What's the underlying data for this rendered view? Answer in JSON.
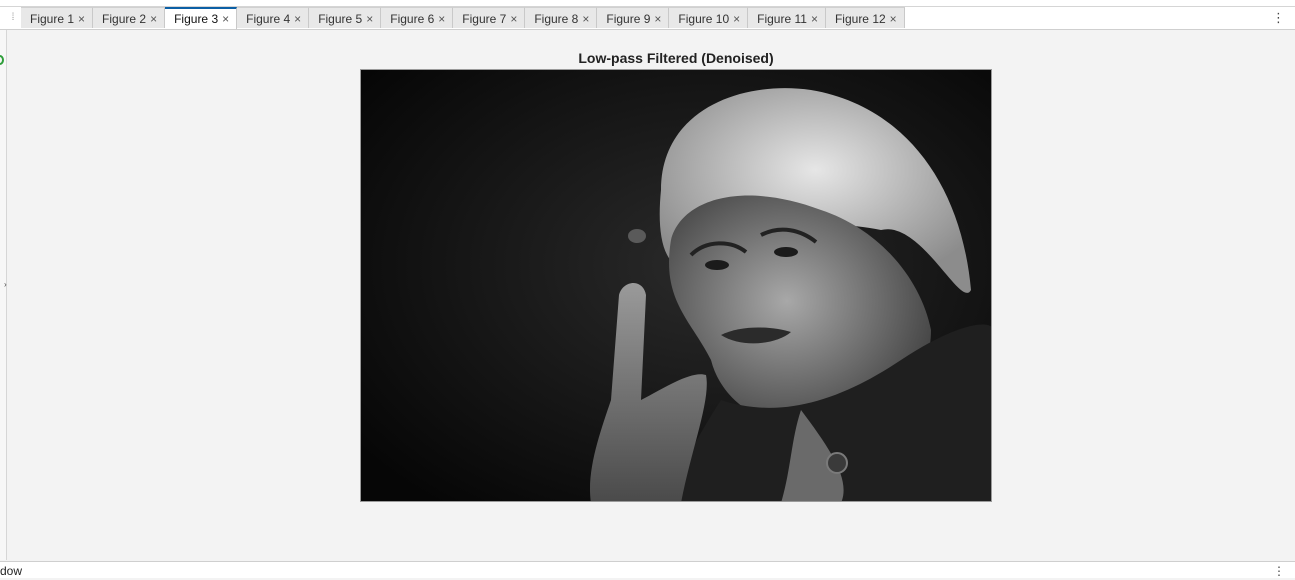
{
  "tabs": [
    {
      "label": "Figure 1",
      "close": "×"
    },
    {
      "label": "Figure 2",
      "close": "×"
    },
    {
      "label": "Figure 3",
      "close": "×",
      "active": true
    },
    {
      "label": "Figure 4",
      "close": "×"
    },
    {
      "label": "Figure 5",
      "close": "×"
    },
    {
      "label": "Figure 6",
      "close": "×"
    },
    {
      "label": "Figure 7",
      "close": "×"
    },
    {
      "label": "Figure 8",
      "close": "×"
    },
    {
      "label": "Figure 9",
      "close": "×"
    },
    {
      "label": "Figure 10",
      "close": "×"
    },
    {
      "label": "Figure 11",
      "close": "×"
    },
    {
      "label": "Figure 12",
      "close": "×"
    }
  ],
  "icons": {
    "grip": "⁞",
    "menu": "⋮",
    "caret": "›"
  },
  "figure": {
    "title": "Low-pass Filtered (Denoised)"
  },
  "status": {
    "text": "dow",
    "menu": "⋮"
  },
  "colors": {
    "active_tab_accent": "#0b5fa5",
    "status_indicator": "#2e9e3a"
  }
}
